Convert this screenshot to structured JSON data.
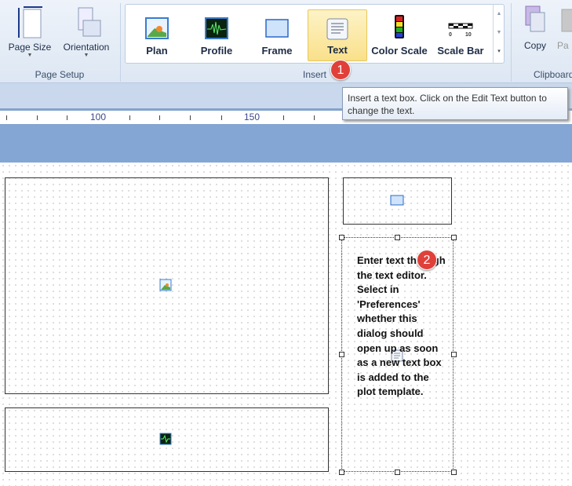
{
  "page_setup": {
    "page_size": "Page Size",
    "orientation": "Orientation",
    "group": "Page Setup"
  },
  "insert": {
    "group": "Insert",
    "items": [
      {
        "label": "Plan"
      },
      {
        "label": "Profile"
      },
      {
        "label": "Frame"
      },
      {
        "label": "Text"
      },
      {
        "label": "Color Scale"
      },
      {
        "label": "Scale Bar"
      }
    ],
    "scale_bar_ticks": [
      "0",
      "10"
    ]
  },
  "clipboard": {
    "copy": "Copy",
    "paste": "Pa",
    "group": "Clipboard"
  },
  "tooltip": "Insert a text box. Click on the Edit Text button to change the text.",
  "ruler": {
    "labels": [
      "100",
      "150"
    ]
  },
  "badges": [
    "1",
    "2"
  ],
  "text_box": "Enter text through the text editor. Select in 'Preferences' whether this dialog should open up as soon as a new text box is added to the plot template."
}
